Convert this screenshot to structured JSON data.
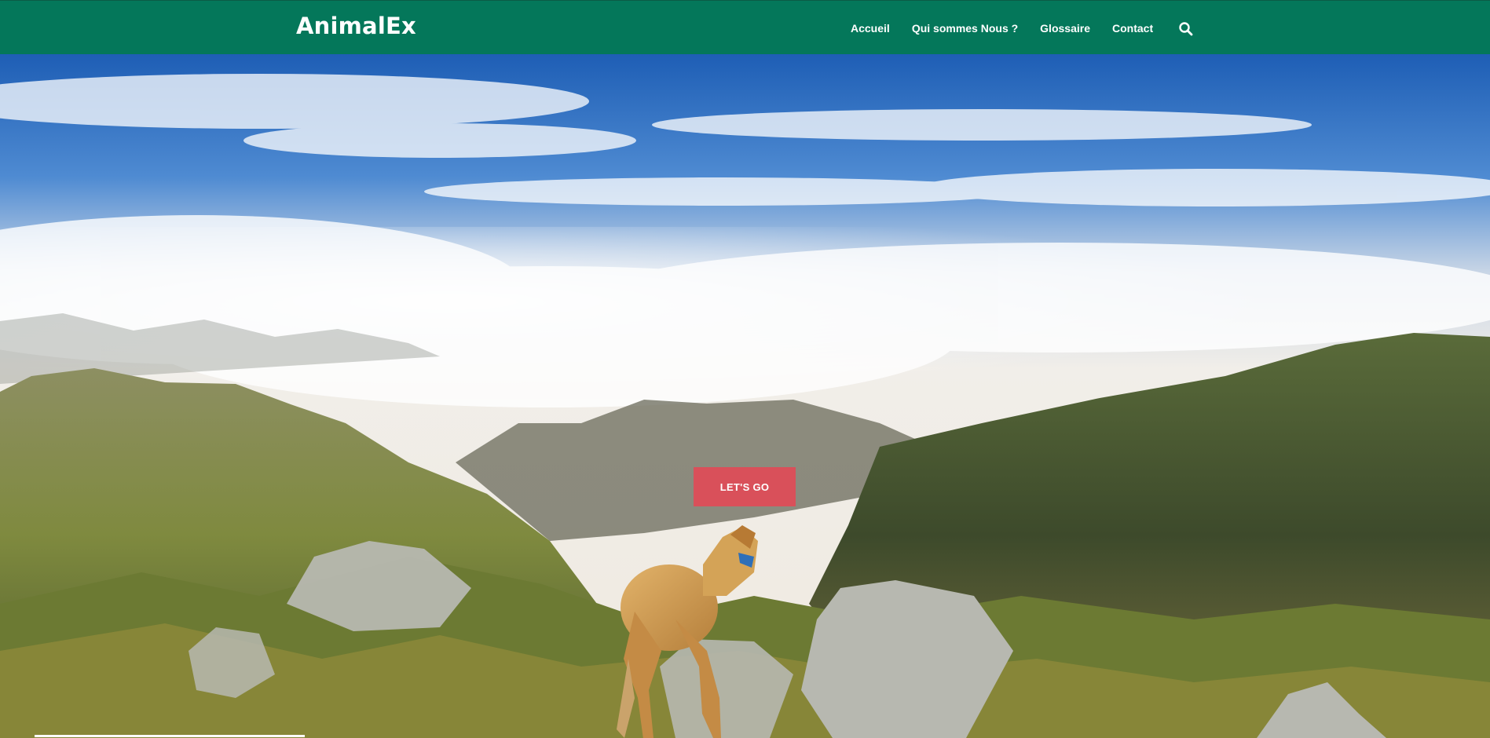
{
  "header": {
    "brand": "AnimalEx",
    "nav": [
      {
        "label": "Accueil"
      },
      {
        "label": "Qui sommes Nous ?"
      },
      {
        "label": "Glossaire"
      },
      {
        "label": "Contact"
      }
    ],
    "search_icon": "search-icon"
  },
  "hero": {
    "cta_label": "LET'S GO",
    "image": "mountain-dog-landscape"
  },
  "colors": {
    "nav_bg": "#04775a",
    "cta_bg": "#d9505a",
    "text": "#ffffff"
  }
}
